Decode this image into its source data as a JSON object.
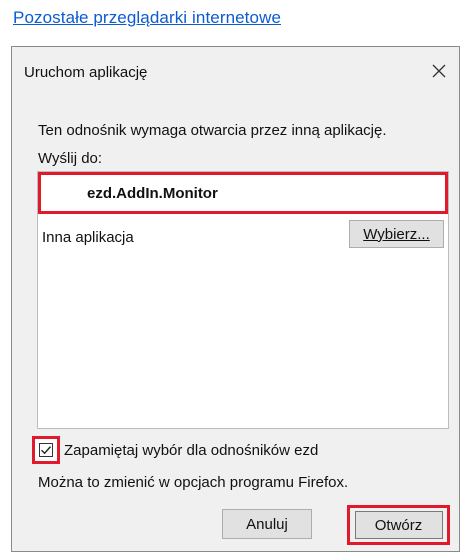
{
  "top_link": "Pozostałe przeglądarki internetowe",
  "dialog": {
    "title": "Uruchom aplikację",
    "message": "Ten odnośnik wymaga otwarcia przez inną aplikację.",
    "send_to_label": "Wyślij do:",
    "apps": [
      {
        "label": "ezd.AddIn.Monitor",
        "selected": true
      },
      {
        "label": "Inna aplikacja"
      }
    ],
    "choose_button": "Wybierz...",
    "remember_label": "Zapamiętaj wybór dla odnośników ezd",
    "remember_checked": true,
    "hint": "Można to zmienić w opcjach programu Firefox.",
    "cancel_button": "Anuluj",
    "open_button": "Otwórz"
  },
  "colors": {
    "highlight": "#e11a2b",
    "link": "#0b5bd3",
    "dialog_bg": "#f0f0f0"
  },
  "icons": {
    "close": "close-icon",
    "check": "checkmark-icon"
  }
}
